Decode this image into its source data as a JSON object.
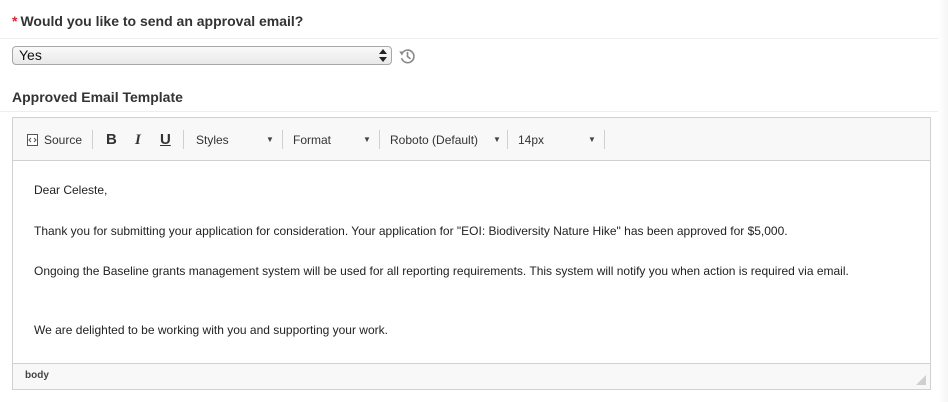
{
  "question": {
    "required_marker": "*",
    "text": "Would you like to send an approval email?"
  },
  "select": {
    "value": "Yes"
  },
  "template_section": {
    "label": "Approved Email Template"
  },
  "toolbar": {
    "source_label": "Source",
    "bold_label": "B",
    "italic_label": "I",
    "underline_label": "U",
    "styles_label": "Styles",
    "format_label": "Format",
    "font_label": "Roboto (Default)",
    "size_label": "14px"
  },
  "content": {
    "greeting": "Dear Celeste,",
    "para1": "Thank you for submitting your application for consideration. Your application for \"EOI: Biodiversity Nature Hike\" has been approved for $5,000.",
    "para2": "Ongoing the Baseline grants management system will be used for all reporting requirements.  This system will notify you when action is required via email.",
    "para3": "We are delighted to be working with you and supporting your work."
  },
  "statusbar": {
    "path": "body"
  },
  "colors": {
    "required": "#d9262f",
    "toolbar_bg": "#f8f8f8",
    "border": "#d1d1d1"
  },
  "icons": {
    "history": "history-icon",
    "source": "source-icon",
    "select_arrows": "updown-arrows-icon",
    "resize": "resize-handle-icon"
  }
}
